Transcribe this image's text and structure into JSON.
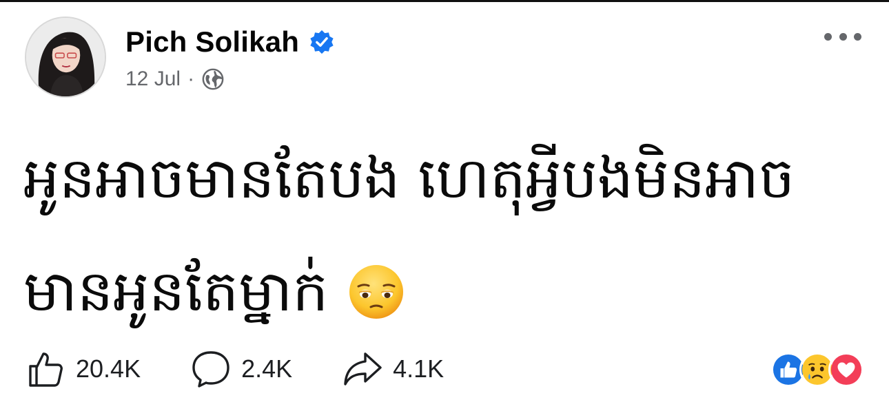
{
  "post": {
    "author": "Pich Solikah",
    "verified": true,
    "date": "12 Jul",
    "separator": "·",
    "privacy_icon": "globe-icon",
    "more_icon": "more-options-icon",
    "text_lines": [
      "អូនអាចមានតែបង ហេតុអ្វីបងមិនអាច",
      "មានអូនតែម្នាក់"
    ],
    "emoji": "pensive-face-emoji"
  },
  "actions": {
    "like_count": "20.4K",
    "comment_count": "2.4K",
    "share_count": "4.1K"
  },
  "reactions": [
    "like",
    "sad",
    "love"
  ],
  "colors": {
    "verified_blue": "#1877f2",
    "like_blue": "#1b74e4",
    "love_red": "#f33e58",
    "secondary_text": "#65676b"
  }
}
